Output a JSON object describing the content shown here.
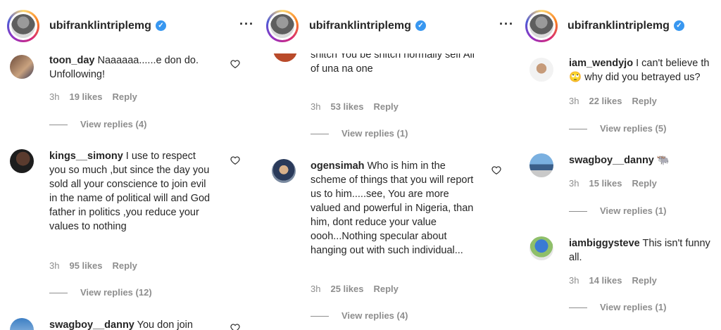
{
  "panels": [
    {
      "username": "ubifranklintriplemg",
      "comments": [
        {
          "user": "toon_day",
          "text": "Naaaaaa......e don do. Unfollowing!",
          "time": "3h",
          "likes": "19 likes",
          "reply": "Reply",
          "view_replies": "View replies (4)"
        },
        {
          "user": "kings__simony",
          "text": "I use to respect you so much ,but since the day you sold all your conscience to join evil in the name of political will and God father in politics ,you reduce your values to nothing",
          "time": "3h",
          "likes": "95 likes",
          "reply": "Reply",
          "view_replies": "View replies (12)"
        },
        {
          "user": "swagboy__danny",
          "text": "You don join"
        }
      ]
    },
    {
      "username": "ubifranklintriplemg",
      "comments": [
        {
          "user": "",
          "text": "snitch You be snitch normally self All of una na one",
          "time": "3h",
          "likes": "53 likes",
          "reply": "Reply",
          "view_replies": "View replies (1)"
        },
        {
          "user": "ogensimah",
          "text": "Who is him in the scheme of things that you will report us to him.....see, You are more valued and powerful in Nigeria, than him, dont reduce your value oooh...Nothing specular about hanging out with such individual...",
          "time": "3h",
          "likes": "25 likes",
          "reply": "Reply",
          "view_replies": "View replies (4)"
        }
      ]
    },
    {
      "username": "ubifranklintriplemg",
      "comments": [
        {
          "user": "iam_wendyjo",
          "text": "I can't believe th",
          "text2": "why did you betrayed us?",
          "emoji": "🙄",
          "time": "3h",
          "likes": "22 likes",
          "reply": "Reply",
          "view_replies": "View replies (5)"
        },
        {
          "user": "swagboy__danny",
          "text": "",
          "emoji": "🐃",
          "time": "3h",
          "likes": "15 likes",
          "reply": "Reply",
          "view_replies": "View replies (1)"
        },
        {
          "user": "iambiggysteve",
          "text": "This isn't funny",
          "text2": "all.",
          "time": "3h",
          "likes": "14 likes",
          "reply": "Reply",
          "view_replies": "View replies (1)"
        }
      ]
    }
  ],
  "icons": {
    "more": "more-horizontal-icon",
    "verified": "verified-badge-icon",
    "heart": "heart-outline-icon"
  }
}
